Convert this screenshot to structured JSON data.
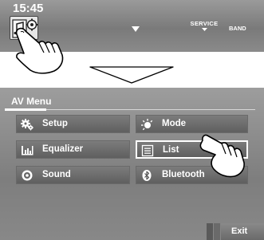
{
  "status": {
    "clock": "15:45"
  },
  "top_bar": {
    "service_label": "SERVICE",
    "band_label": "BAND"
  },
  "av_menu": {
    "title": "AV Menu",
    "items": [
      {
        "label": "Setup",
        "icon": "gear-icon"
      },
      {
        "label": "Equalizer",
        "icon": "equalizer-icon"
      },
      {
        "label": "Sound",
        "icon": "speaker-icon"
      },
      {
        "label": "Mode",
        "icon": "sun-icon"
      },
      {
        "label": "List",
        "icon": "list-icon"
      },
      {
        "label": "Bluetooth",
        "icon": "bluetooth-icon"
      }
    ],
    "selected": "List",
    "exit_label": "Exit"
  },
  "colors": {
    "panel": "#8a8a8a",
    "button": "#6a6a6a",
    "text": "#ffffff"
  }
}
